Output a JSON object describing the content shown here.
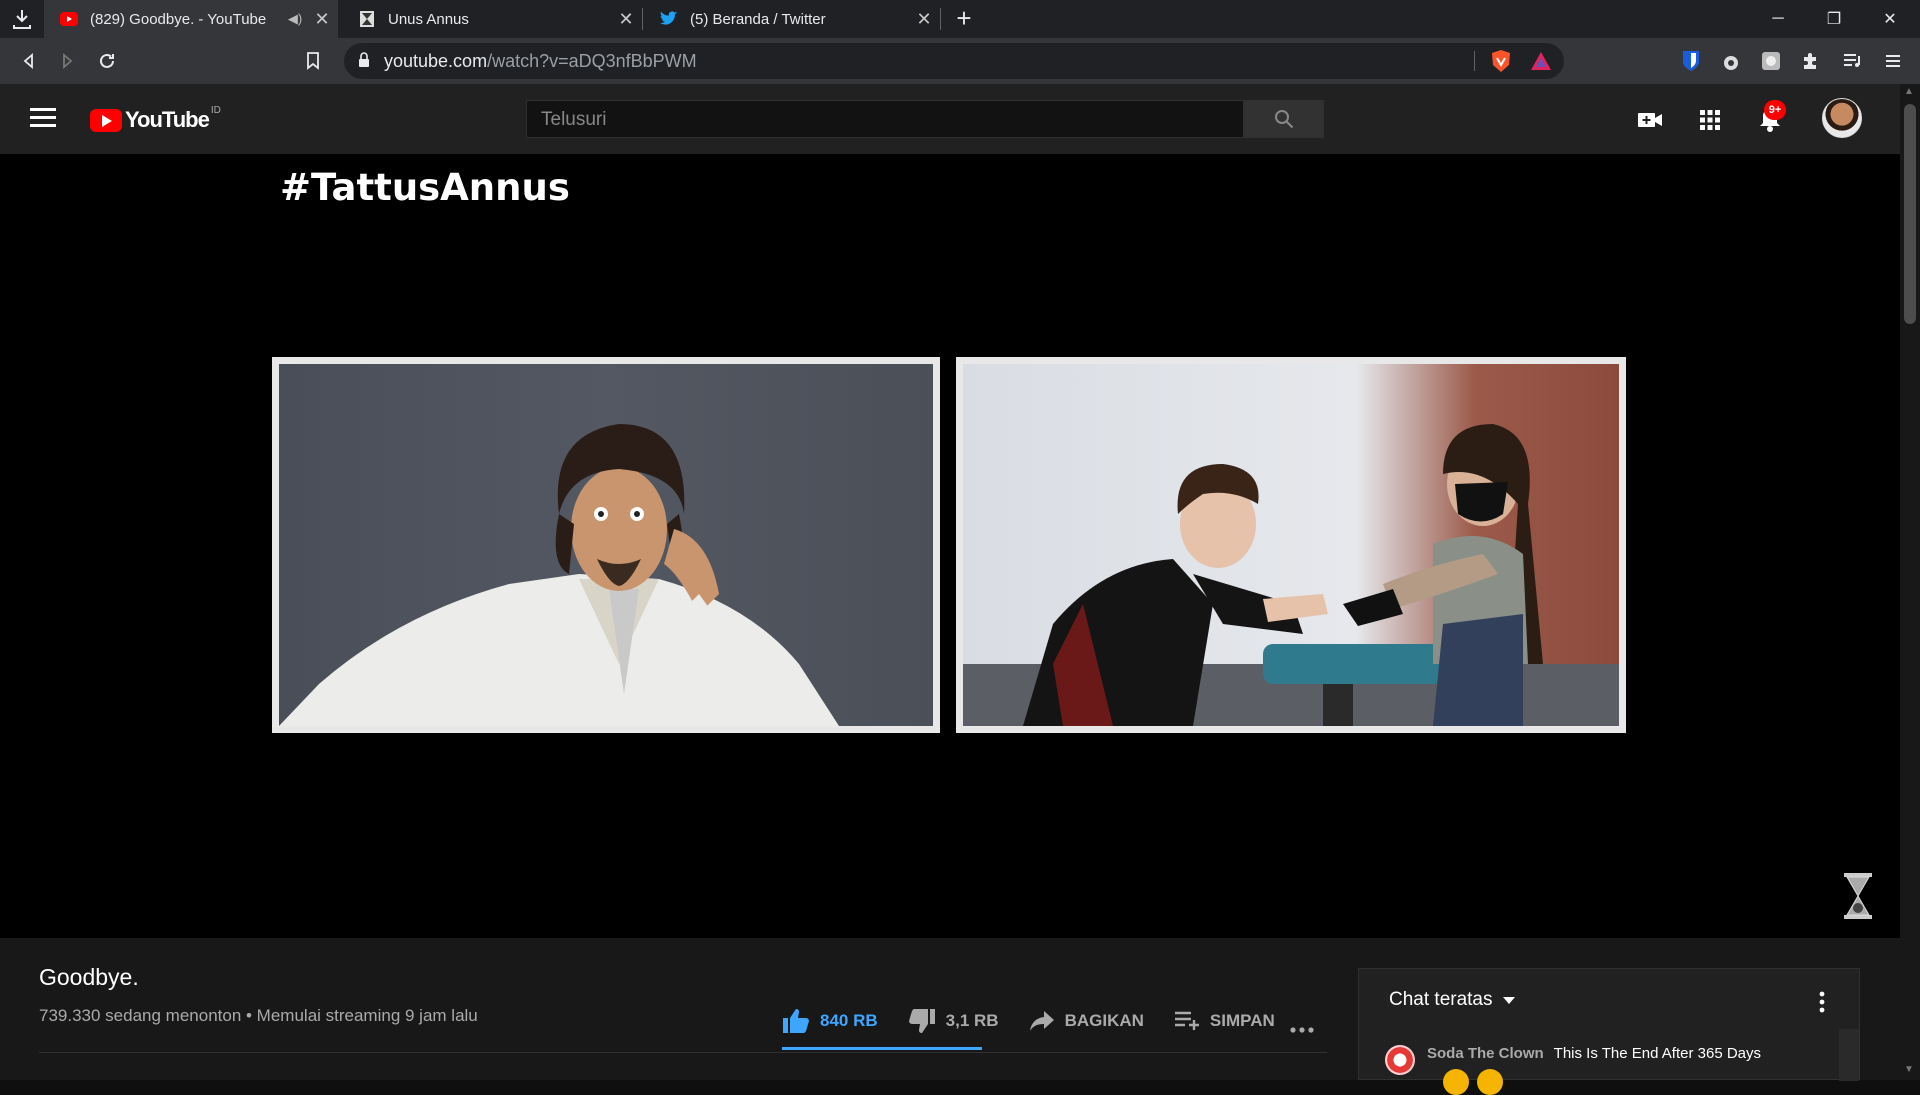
{
  "browser": {
    "tabs": [
      {
        "title": "(829) Goodbye. - YouTube",
        "active": true,
        "audio": true
      },
      {
        "title": "Unus Annus",
        "active": false
      },
      {
        "title": "(5) Beranda / Twitter",
        "active": false
      }
    ],
    "new_tab": "+",
    "url_host": "youtube.com",
    "url_path": "/watch?v=aDQ3nfBbPWM",
    "window_controls": [
      "minimize",
      "restore",
      "close"
    ]
  },
  "youtube": {
    "logo_word": "YouTube",
    "country_code": "ID",
    "search_placeholder": "Telusuri",
    "notification_count": "9+"
  },
  "video": {
    "overlay_title": "#TattusAnnus",
    "title": "Goodbye.",
    "meta": "739.330 sedang menonton • Memulai streaming 9 jam lalu",
    "likes": "840 RB",
    "dislikes": "3,1 RB",
    "share": "BAGIKAN",
    "save": "SIMPAN"
  },
  "chat": {
    "title": "Chat teratas",
    "messages": [
      {
        "author": "Soda The Clown",
        "text": "This Is The End After 365 Days"
      }
    ]
  },
  "colors": {
    "accent_blue": "#3ea6ff",
    "youtube_red": "#ff0000",
    "bg": "#181818"
  }
}
